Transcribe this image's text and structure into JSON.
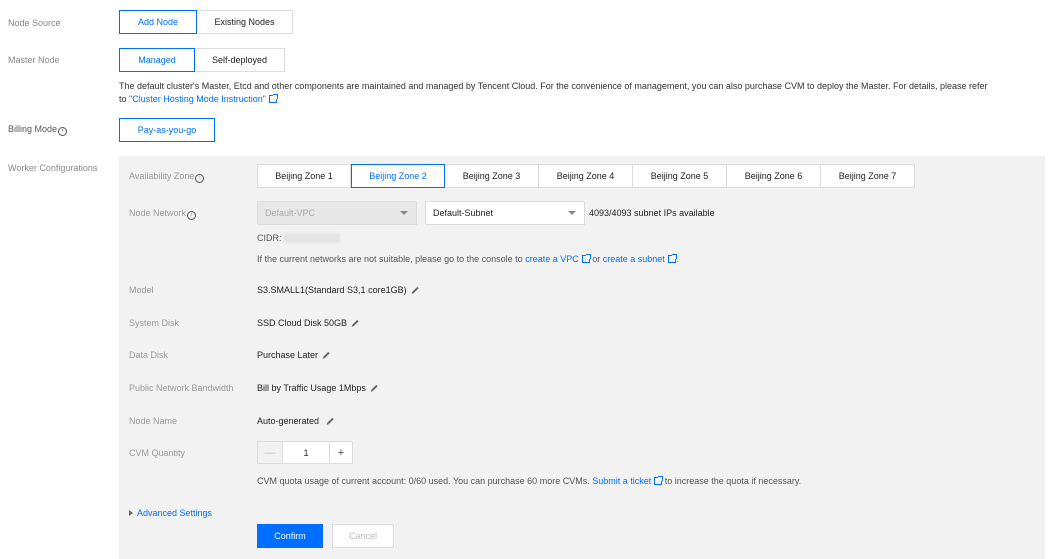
{
  "node_source": {
    "label": "Node Source",
    "options": [
      "Add Node",
      "Existing Nodes"
    ],
    "selected": "Add Node"
  },
  "master_node": {
    "label": "Master Node",
    "options": [
      "Managed",
      "Self-deployed"
    ],
    "selected": "Managed",
    "description": "The default cluster's Master, Etcd and other components are maintained and managed by Tencent Cloud. For the convenience of management, you can also purchase CVM to deploy the Master. For details, please refer",
    "description_prefix": "to ",
    "link_text": "\"Cluster Hosting Mode Instruction\""
  },
  "billing_mode": {
    "label": "Billing Mode",
    "option": "Pay-as-you-go"
  },
  "worker": {
    "label": "Worker Configurations",
    "availability_zone": {
      "label": "Availability Zone",
      "zones": [
        "Beijing Zone 1",
        "Beijing Zone 2",
        "Beijing Zone 3",
        "Beijing Zone 4",
        "Beijing Zone 5",
        "Beijing Zone 6",
        "Beijing Zone 7"
      ],
      "selected": "Beijing Zone 2"
    },
    "node_network": {
      "label": "Node Network",
      "vpc": "Default-VPC",
      "subnet": "Default-Subnet",
      "ips_available": "4093/4093 subnet IPs available",
      "cidr_label": "CIDR:",
      "hint_prefix": "If the current networks are not suitable, please go to the console to",
      "create_vpc": "create a VPC",
      "or": "or",
      "create_subnet": "create a subnet",
      "hint_suffix": "."
    },
    "model": {
      "label": "Model",
      "value": "S3.SMALL1(Standard S3,1 core1GB)"
    },
    "system_disk": {
      "label": "System Disk",
      "value": "SSD Cloud Disk 50GB"
    },
    "data_disk": {
      "label": "Data Disk",
      "value": "Purchase Later"
    },
    "bandwidth": {
      "label": "Public Network Bandwidth",
      "value": "Bill by Traffic Usage 1Mbps"
    },
    "node_name": {
      "label": "Node Name",
      "value": "Auto-generated"
    },
    "cvm_quantity": {
      "label": "CVM Quantity",
      "minus": "—",
      "value": "1",
      "plus": "+",
      "quota_text": "CVM quota usage of current account: 0/60 used. You can purchase 60 more CVMs.",
      "ticket_link": "Submit a ticket",
      "quota_suffix": "to increase the quota if necessary."
    },
    "advanced_settings": "Advanced Settings",
    "confirm": "Confirm",
    "cancel": "Cancel"
  },
  "colors": {
    "accent": "#006eff",
    "panel_bg": "#f2f2f2"
  }
}
